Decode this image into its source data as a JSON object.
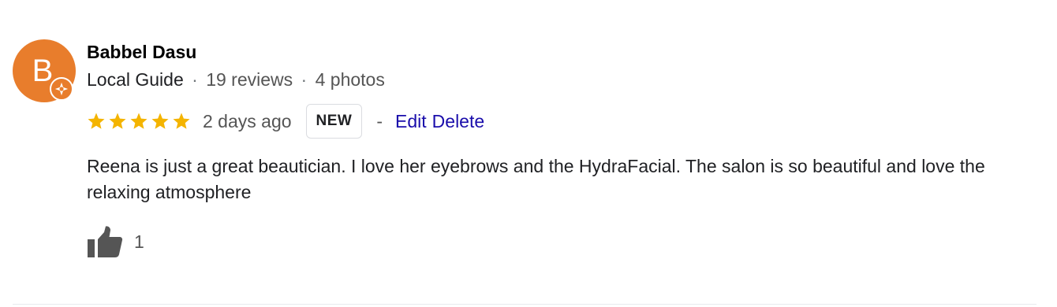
{
  "reviewer": {
    "initial": "B",
    "avatar_color": "#e87d2c",
    "name": "Babbel Dasu",
    "badge_icon": "local-guide-star-icon",
    "guide_label": "Local Guide",
    "reviews": "19 reviews",
    "photos": "4 photos",
    "separator": "·"
  },
  "rating": {
    "stars": 5,
    "max_stars": 5,
    "star_color": "#f4b400",
    "icon": "star-icon"
  },
  "date": "2 days ago",
  "new_badge": "NEW",
  "actions": {
    "separator": "-",
    "edit_label": "Edit",
    "delete_label": "Delete",
    "link_color": "#1a0dab"
  },
  "review_text": "Reena is just a great beautician. I love her eyebrows and the HydraFacial. The salon is so beautiful and love the relaxing atmosphere",
  "likes": {
    "icon": "thumbs-up-icon",
    "count": "1"
  }
}
